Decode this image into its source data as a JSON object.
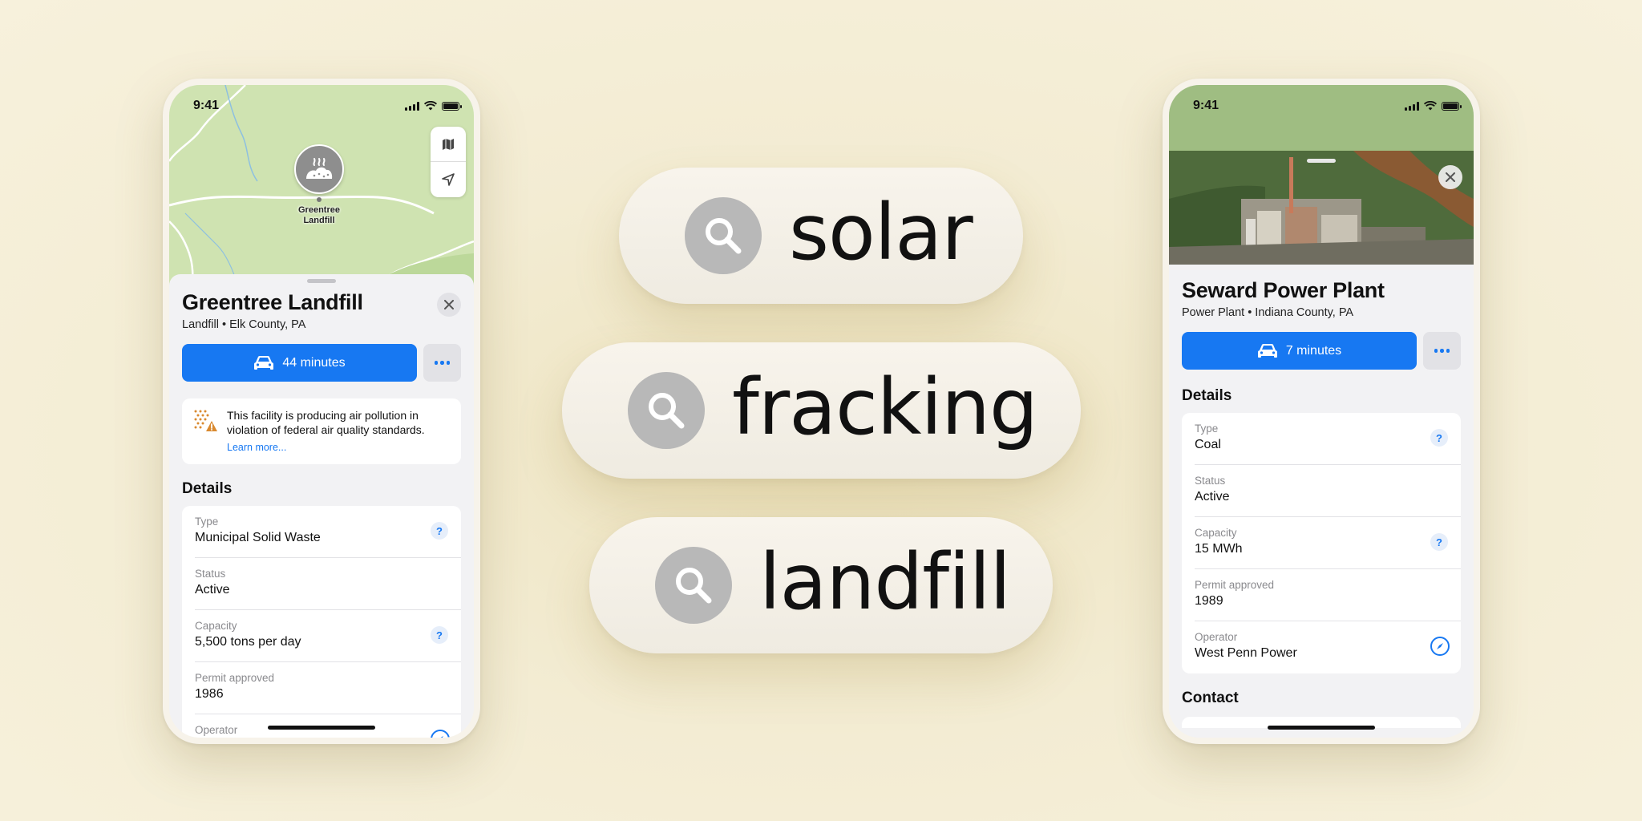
{
  "left_phone": {
    "time": "9:41",
    "map_pin_label": "Greentree\nLandfill",
    "title": "Greentree Landfill",
    "subtitle": "Landfill • Elk County, PA",
    "directions_label": "44 minutes",
    "warning_text": "This facility is producing air pollution in violation of federal air quality standards.",
    "warning_link": "Learn more...",
    "details_title": "Details",
    "details": [
      {
        "label": "Type",
        "value": "Municipal Solid Waste",
        "icon": "info-icon"
      },
      {
        "label": "Status",
        "value": "Active",
        "icon": ""
      },
      {
        "label": "Capacity",
        "value": "5,500 tons per day",
        "icon": "info-icon"
      },
      {
        "label": "Permit approved",
        "value": "1986",
        "icon": ""
      },
      {
        "label": "Operator",
        "value": "",
        "icon": "compass-icon"
      }
    ]
  },
  "right_phone": {
    "time": "9:41",
    "title": "Seward Power Plant",
    "subtitle": "Power Plant • Indiana County, PA",
    "directions_label": "7 minutes",
    "details_title": "Details",
    "details": [
      {
        "label": "Type",
        "value": "Coal",
        "icon": "info-icon"
      },
      {
        "label": "Status",
        "value": "Active",
        "icon": ""
      },
      {
        "label": "Capacity",
        "value": "15 MWh",
        "icon": "info-icon"
      },
      {
        "label": "Permit approved",
        "value": "1989",
        "icon": ""
      },
      {
        "label": "Operator",
        "value": "West Penn Power",
        "icon": "compass-icon"
      }
    ],
    "contact_title": "Contact"
  },
  "search_pills": [
    {
      "query": "solar"
    },
    {
      "query": "fracking"
    },
    {
      "query": "landfill"
    }
  ],
  "colors": {
    "accent_blue": "#1778f2",
    "background": "#f5eed4",
    "map_green": "#cfe3b1",
    "search_icon_gray": "#b8b8b8"
  }
}
